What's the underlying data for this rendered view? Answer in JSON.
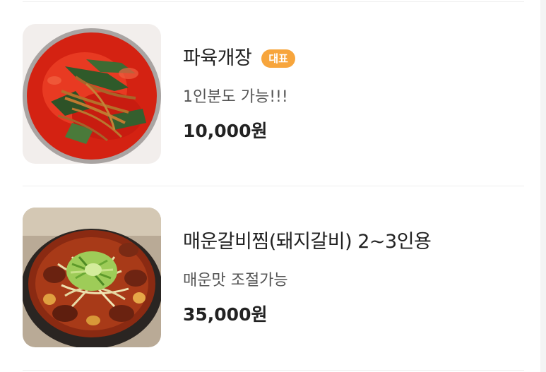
{
  "menu": {
    "items": [
      {
        "name": "파육개장",
        "badge": "대표",
        "description": "1인분도 가능!!!",
        "price": "10,000원",
        "image_icon": "yukgaejang-soup-photo"
      },
      {
        "name": "매운갈비찜(돼지갈비) 2~3인용",
        "description": "매운맛 조절가능",
        "price": "35,000원",
        "image_icon": "galbijjim-pot-photo"
      }
    ]
  },
  "colors": {
    "badge_bg": "#f7a53c",
    "text_primary": "#222222",
    "text_secondary": "#555555",
    "divider": "#ededed"
  }
}
